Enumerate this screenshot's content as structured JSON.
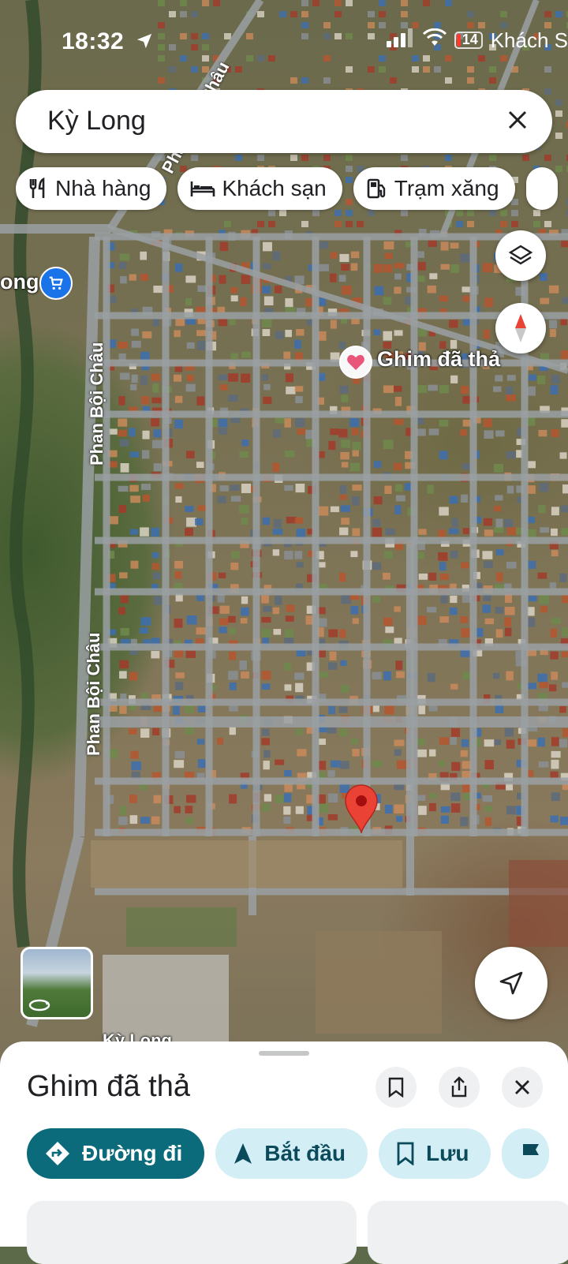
{
  "status_bar": {
    "time": "18:32",
    "back_app": "Khách S",
    "battery_level": "14"
  },
  "search": {
    "value": "Kỳ Long"
  },
  "chips": [
    {
      "label": "Nhà hàng",
      "icon": "restaurant-icon"
    },
    {
      "label": "Khách sạn",
      "icon": "hotel-icon"
    },
    {
      "label": "Trạm xăng",
      "icon": "gas-station-icon"
    }
  ],
  "map": {
    "pin_label": "Ghim đã thả",
    "poi_left_label": "ong",
    "poi_bottom_label": "Kỳ Long",
    "streets": [
      "Phan Bội Châu",
      "Phan Bội Châu",
      "Phan Bội Châu"
    ]
  },
  "sheet": {
    "title": "Ghim đã thả",
    "actions": [
      {
        "label": "Đường đi",
        "icon": "directions-icon"
      },
      {
        "label": "Bắt đầu",
        "icon": "navigation-arrow-icon"
      },
      {
        "label": "Lưu",
        "icon": "bookmark-icon"
      }
    ]
  },
  "colors": {
    "primary": "#0b6b7b",
    "secondary_pill": "#d4eef6",
    "pin_red": "#ea4335"
  }
}
